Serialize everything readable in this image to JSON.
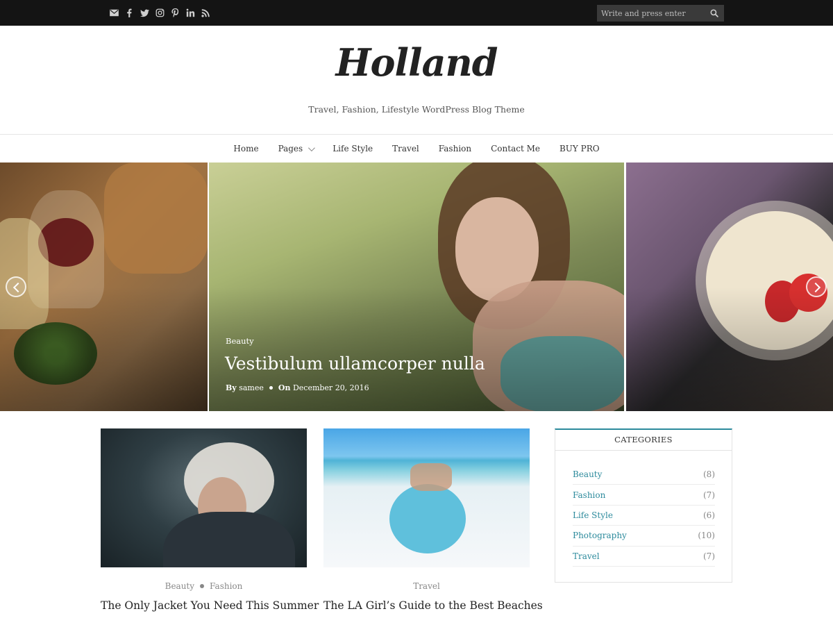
{
  "topbar": {
    "social_icons": [
      "email-icon",
      "facebook-icon",
      "twitter-icon",
      "instagram-icon",
      "pinterest-icon",
      "linkedin-icon",
      "rss-icon"
    ],
    "search_placeholder": "Write and press enter"
  },
  "header": {
    "logo": "Holland",
    "tagline": "Travel, Fashion, Lifestyle WordPress Blog Theme"
  },
  "nav": {
    "items": [
      {
        "label": "Home"
      },
      {
        "label": "Pages",
        "has_dropdown": true
      },
      {
        "label": "Life Style"
      },
      {
        "label": "Travel"
      },
      {
        "label": "Fashion"
      },
      {
        "label": "Contact Me"
      },
      {
        "label": "BUY PRO"
      }
    ]
  },
  "slider": {
    "featured": {
      "category": "Beauty",
      "title": "Vestibulum ullamcorper nulla",
      "by_label": "By",
      "author": "samee",
      "on_label": "On",
      "date": "December 20, 2016"
    }
  },
  "posts": [
    {
      "categories": [
        "Beauty",
        "Fashion"
      ],
      "title": "The Only Jacket You Need This Summer"
    },
    {
      "categories": [
        "Travel"
      ],
      "title": "The LA Girl’s Guide to the Best Beaches"
    }
  ],
  "sidebar": {
    "categories_title": "CATEGORIES",
    "categories": [
      {
        "name": "Beauty",
        "count": "(8)"
      },
      {
        "name": "Fashion",
        "count": "(7)"
      },
      {
        "name": "Life Style",
        "count": "(6)"
      },
      {
        "name": "Photography",
        "count": "(10)"
      },
      {
        "name": "Travel",
        "count": "(7)"
      }
    ]
  },
  "colors": {
    "topbar_bg": "#141414",
    "accent": "#2c8a9c"
  }
}
